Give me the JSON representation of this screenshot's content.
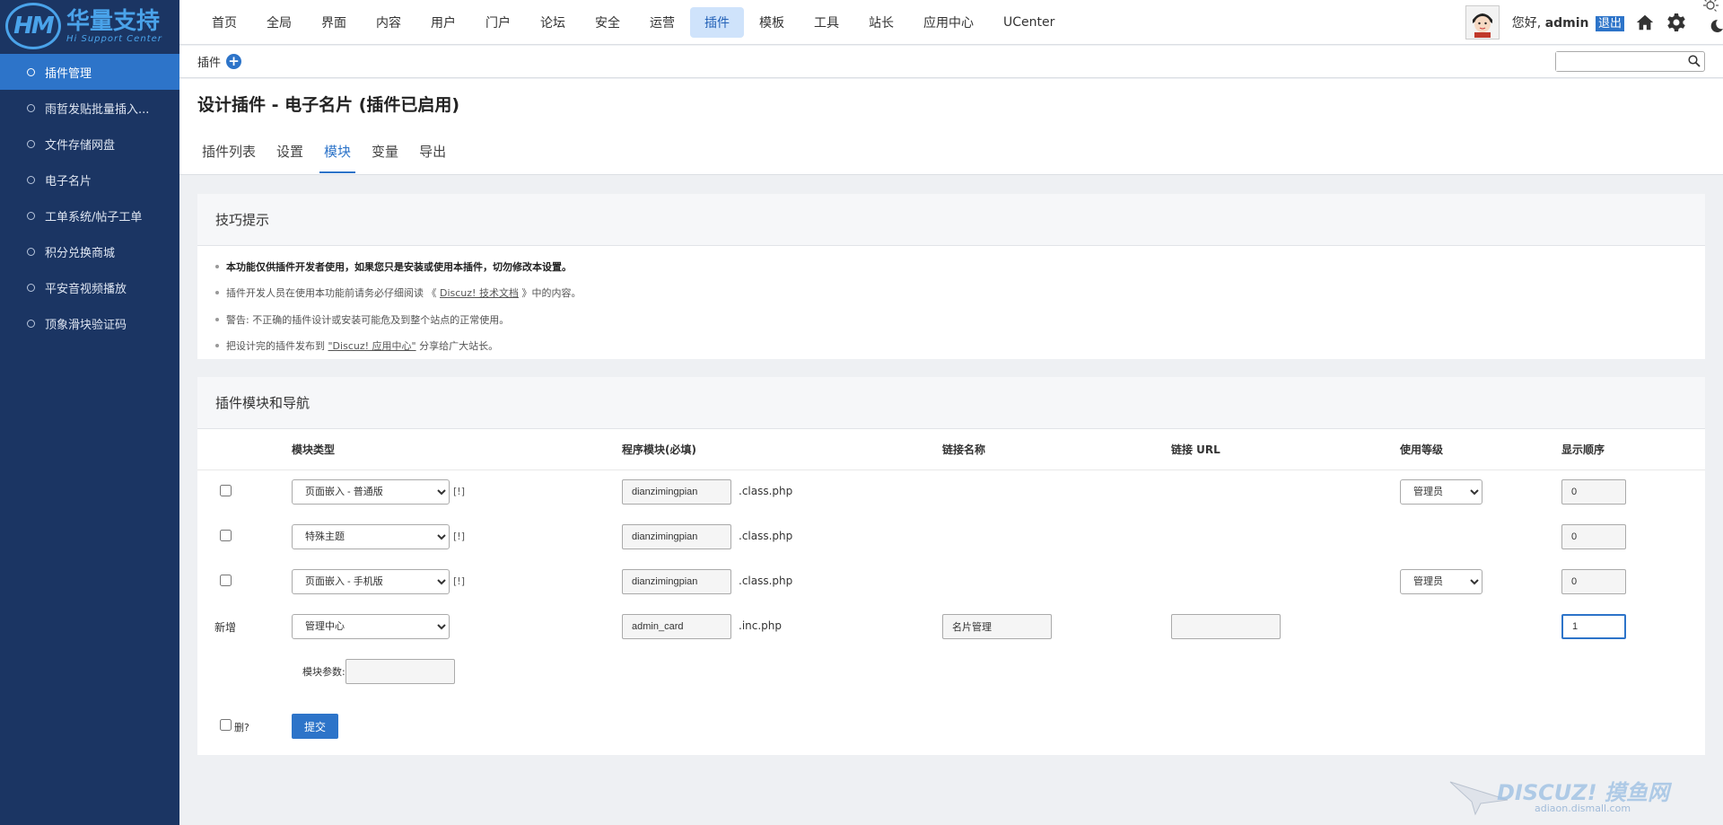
{
  "brand": {
    "logo_mark": "HM",
    "name_cn": "华量支持",
    "name_en": "Hi Support Center"
  },
  "sidebar": {
    "items": [
      {
        "label": "插件管理"
      },
      {
        "label": "雨哲发贴批量插入..."
      },
      {
        "label": "文件存储网盘"
      },
      {
        "label": "电子名片"
      },
      {
        "label": "工单系统/帖子工单"
      },
      {
        "label": "积分兑换商城"
      },
      {
        "label": "平安音视频播放"
      },
      {
        "label": "顶象滑块验证码"
      }
    ]
  },
  "topnav": {
    "items": [
      "首页",
      "全局",
      "界面",
      "内容",
      "用户",
      "门户",
      "论坛",
      "安全",
      "运营",
      "插件",
      "模板",
      "工具",
      "站长",
      "应用中心",
      "UCenter"
    ]
  },
  "user": {
    "greeting": "您好,",
    "name": "admin",
    "logout": "退出"
  },
  "subbar": {
    "title": "插件",
    "add": "+"
  },
  "page": {
    "title": "设计插件 - 电子名片 (插件已启用)",
    "tabs": [
      "插件列表",
      "设置",
      "模块",
      "变量",
      "导出"
    ]
  },
  "tips": {
    "heading": "技巧提示",
    "items": [
      "本功能仅供插件开发者使用，如果您只是安装或使用本插件，切勿修改本设置。",
      "插件开发人员在使用本功能前请务必仔细阅读",
      "警告: 不正确的插件设计或安装可能危及到整个站点的正常使用。",
      "把设计完的插件发布到"
    ],
    "doc_open": "《",
    "doc_link": "Discuz! 技术文档",
    "doc_close": "》中的内容。",
    "app_link": "\"Discuz! 应用中心\"",
    "app_tail": "分享给广大站长。"
  },
  "modules": {
    "heading": "插件模块和导航",
    "columns": [
      "模块类型",
      "程序模块(必填)",
      "链接名称",
      "链接 URL",
      "使用等级",
      "显示顺序"
    ],
    "rows": [
      {
        "type": "页面嵌入 - 普通版",
        "bracket": "[!]",
        "module": "dianzimingpian",
        "suffix": ".class.php",
        "level": "管理员",
        "order": "0"
      },
      {
        "type": "特殊主题",
        "bracket": "[!]",
        "module": "dianzimingpian",
        "suffix": ".class.php",
        "order": "0"
      },
      {
        "type": "页面嵌入 - 手机版",
        "bracket": "[!]",
        "module": "dianzimingpian",
        "suffix": ".class.php",
        "level": "管理员",
        "order": "0"
      }
    ],
    "new_row": {
      "label": "新增",
      "type": "管理中心",
      "module": "admin_card",
      "suffix": ".inc.php",
      "link_name": "名片管理",
      "link_url": "",
      "order": "1"
    },
    "param_label": "模块参数:",
    "delete_label": "删?",
    "submit": "提交"
  },
  "watermark": {
    "text": "DISCUZ! 摸鱼网",
    "sub": "adiaon.dismall.com"
  },
  "colors": {
    "sidebar": "#1b3563",
    "accent": "#2d74c9",
    "nav_active_bg": "#cfe3fb"
  }
}
